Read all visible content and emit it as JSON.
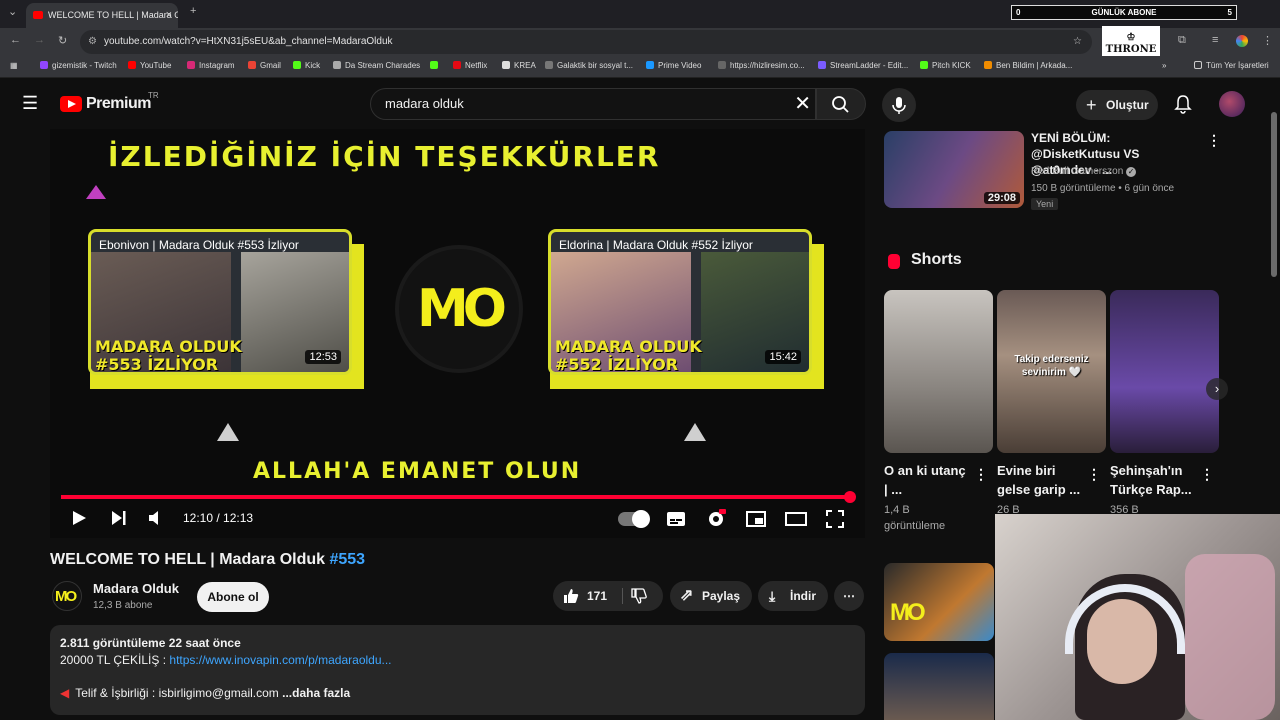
{
  "browser": {
    "tab_title": "WELCOME TO HELL | Madara O",
    "url": "youtube.com/watch?v=HtXN31j5sEU&ab_channel=MadaraOlduk",
    "bookmarks": [
      "gizemistik - Twitch",
      "YouTube",
      "Instagram",
      "Gmail",
      "Kick",
      "Da Stream Charades",
      "Netflix",
      "KREA",
      "Galaktik bir sosyal t...",
      "Prime Video",
      "https://hizliresim.co...",
      "StreamLadder - Edit...",
      "Pitch KICK",
      "Ben Bildim | Arkada...",
      "Tüm Yer İşaretleri"
    ]
  },
  "overlay": {
    "goal_left": "0",
    "goal_label": "GÜNLÜK ABONE",
    "goal_right": "5",
    "throne_label": "THRONE"
  },
  "yt": {
    "brand": "Premium",
    "region": "TR",
    "search_query": "madara olduk",
    "create_label": "Oluştur"
  },
  "video": {
    "endscreen_top": "İZLEDİĞİNİZ İÇİN TEŞEKKÜRLER",
    "endscreen_bottom": "ALLAH'A EMANET OLUN",
    "card1_title": "Ebonivon | Madara Olduk #553 İzliyor",
    "card1_big1": "MADARA OLDUK",
    "card1_big2": "#553 İZLİYOR",
    "card1_duration": "12:53",
    "card2_title": "Eldorina | Madara Olduk #552 İzliyor",
    "card2_big1": "MADARA OLDUK",
    "card2_big2": "#552 İZLİYOR",
    "card2_duration": "15:42",
    "logo_text": "MO",
    "time": "12:10 / 12:13",
    "progress": 0.996
  },
  "watch": {
    "title": "WELCOME TO HELL | Madara Olduk",
    "title_tag": "#553",
    "channel": "Madara Olduk",
    "subscribers": "12,3 B abone",
    "subscribe_label": "Abone ol",
    "likes": "171",
    "share_label": "Paylaş",
    "download_label": "İndir",
    "views_time": "2.811 görüntüleme  22 saat önce",
    "desc_line2_prefix": "20000 TL ÇEKİLİŞ : ",
    "desc_link": "https://www.inovapin.com/p/madaraoldu...",
    "desc_line3": "Telif & İşbirliği : isbirligimo@gmail.com",
    "more_label": "...daha fazla"
  },
  "sidebar": {
    "rec_title": "YENİ BÖLÜM: @DisketKutusu VS @at0mdev - ...",
    "rec_channel": "Red Bull Gamerszon",
    "rec_meta": "150 B görüntüleme • 6 gün önce",
    "rec_badge": "Yeni",
    "rec_duration": "29:08",
    "shorts_heading": "Shorts",
    "shorts": [
      {
        "title": "O an ki utanç | ...",
        "meta": "1,4 B görüntüleme"
      },
      {
        "title": "Evine biri gelse garip ...",
        "meta": "26 B",
        "overlay": "Takip ederseniz sevinirim 🤍"
      },
      {
        "title": "Şehinşah'ın Türkçe Rap...",
        "meta": "356 B"
      }
    ]
  },
  "colors": {
    "accent_red": "#ff0033",
    "link_blue": "#3ea6ff",
    "endscreen_yellow": "#e8f030"
  }
}
